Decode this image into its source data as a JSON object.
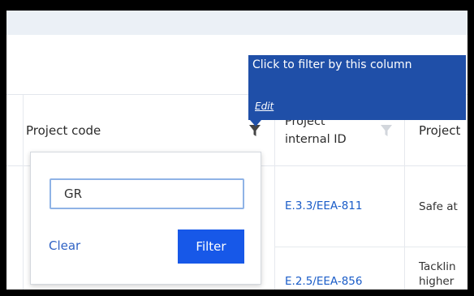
{
  "table": {
    "headers": {
      "project_code": "Project code",
      "internal_id_line1": "Project",
      "internal_id_line2": "internal ID",
      "project_name": "Project"
    },
    "rows": [
      {
        "internal_id": "E.3.3/EEA-811",
        "project_name": "Safe at"
      },
      {
        "internal_id": "E.2.5/EEA-856",
        "project_name_line1": "Tacklin",
        "project_name_line2": "higher"
      }
    ]
  },
  "filter_popup": {
    "input_value": "GR",
    "clear_label": "Clear",
    "filter_label": "Filter"
  },
  "tooltip": {
    "text": "Click to filter by this column",
    "edit_label": "Edit"
  },
  "colors": {
    "tooltip_bg": "#1f4fa8",
    "filter_button": "#1758e8",
    "link": "#1a5cc8"
  }
}
